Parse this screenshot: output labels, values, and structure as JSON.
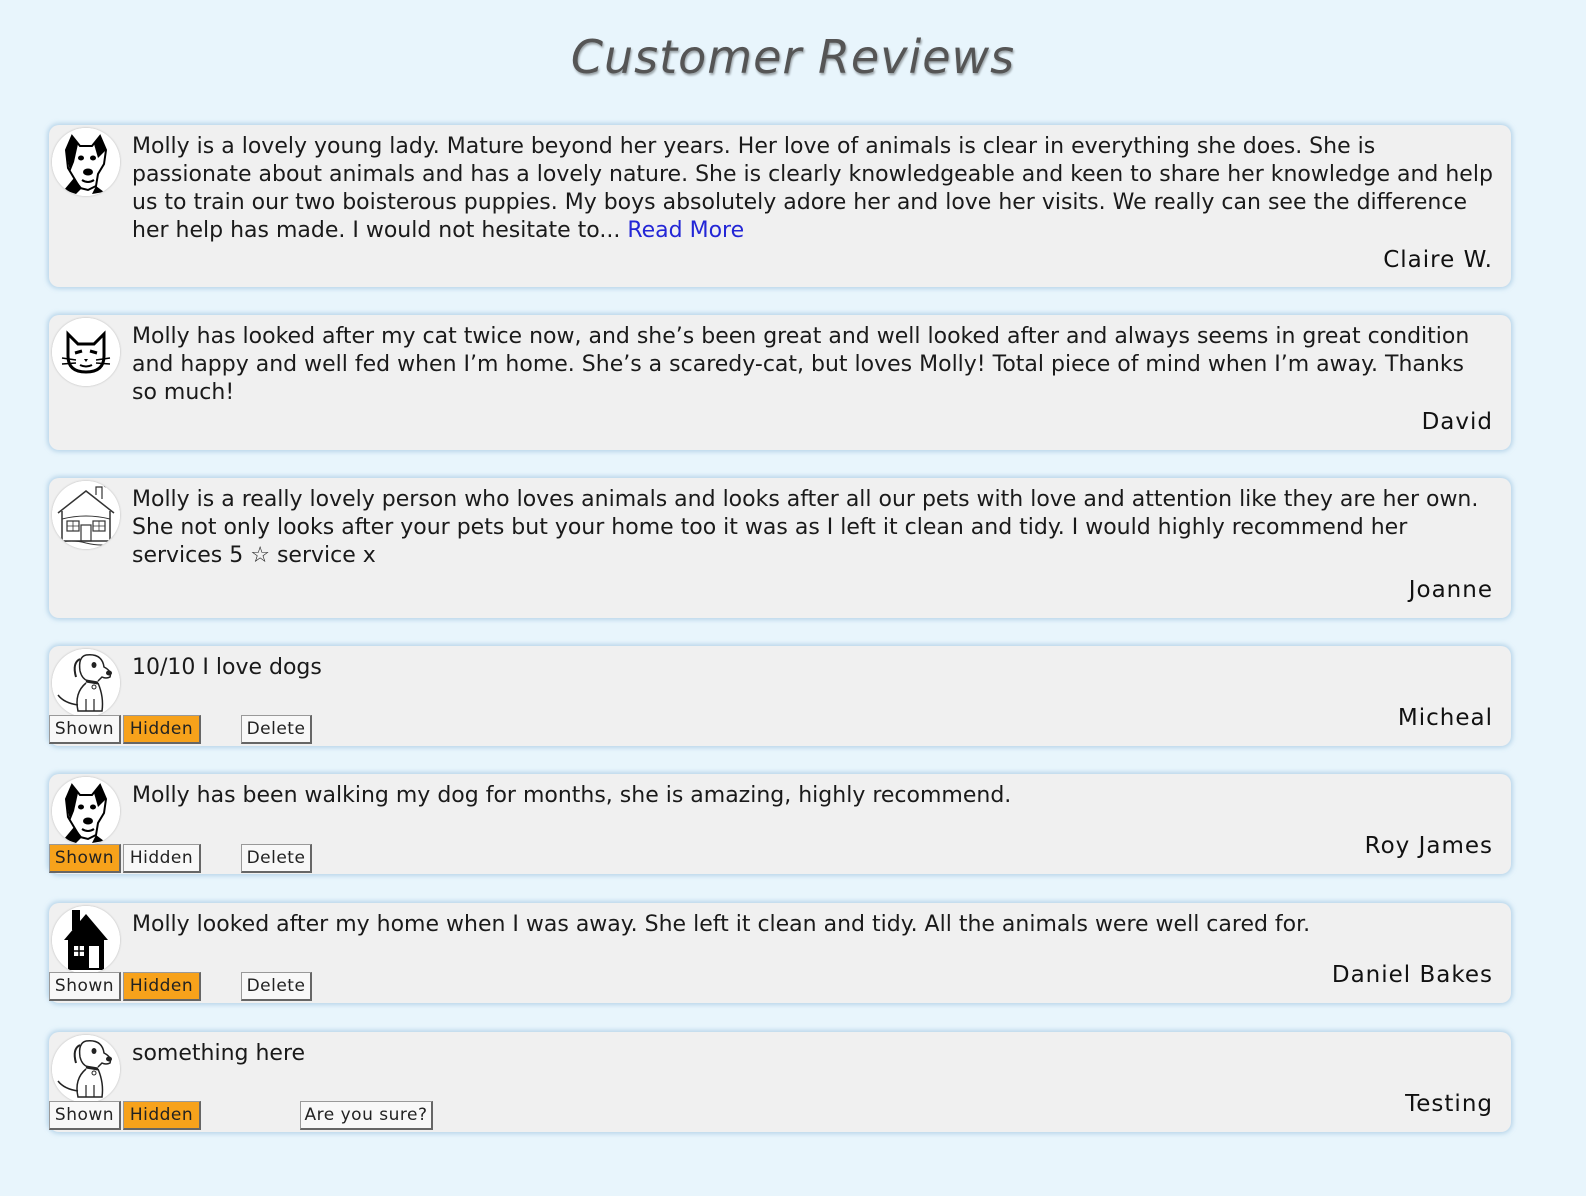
{
  "page": {
    "title": "Customer Reviews"
  },
  "colors": {
    "background": "#e8f5fc",
    "card": "#f0f0f0",
    "active_toggle": "#f7a21b",
    "link": "#2326d6"
  },
  "reviews": [
    {
      "avatar_icon": "pitbull-dog-icon",
      "text": "Molly is a lovely young lady. Mature beyond her years. Her love of animals is clear in everything she does. She is passionate about animals and has a lovely nature. She is clearly knowledgeable and keen to share her knowledge and help us to train our two boisterous puppies. My boys absolutely adore her and love her visits. We really can see the difference her help has made. I would not hesitate to... ",
      "read_more": "Read More",
      "author": "Claire W."
    },
    {
      "avatar_icon": "cat-face-icon",
      "text": "Molly has looked after my cat twice now, and she’s been great and well looked after and always seems in great condition and happy and well fed when I’m home. She’s a scaredy-cat, but loves Molly! Total piece of mind when I’m away. Thanks so much!",
      "author": "David"
    },
    {
      "avatar_icon": "house-sketch-icon",
      "text": "Molly is a really lovely person who loves animals and looks after all our pets with love and attention like they are her own. She not only looks after your pets but your home too it was as I left it clean and tidy. I would highly recommend her services 5 ☆ service x",
      "author": "Joanne"
    },
    {
      "avatar_icon": "sitting-dog-icon",
      "text": "10/10 I love dogs",
      "author": "Micheal",
      "status": "Hidden",
      "shown_label": "Shown",
      "hidden_label": "Hidden",
      "delete_label": "Delete"
    },
    {
      "avatar_icon": "pitbull-dog-icon",
      "text": "Molly has been walking my dog for months, she is amazing, highly recommend.",
      "author": "Roy James",
      "status": "Shown",
      "shown_label": "Shown",
      "hidden_label": "Hidden",
      "delete_label": "Delete"
    },
    {
      "avatar_icon": "house-icon",
      "text": "Molly looked after my home when I was away. She left it clean and tidy. All the animals were well cared for.",
      "author": "Daniel Bakes",
      "status": "Hidden",
      "shown_label": "Shown",
      "hidden_label": "Hidden",
      "delete_label": "Delete"
    },
    {
      "avatar_icon": "sitting-dog-icon",
      "text": "something here",
      "author": "Testing",
      "status": "Hidden",
      "shown_label": "Shown",
      "hidden_label": "Hidden",
      "confirm_label": "Are you sure?"
    }
  ]
}
